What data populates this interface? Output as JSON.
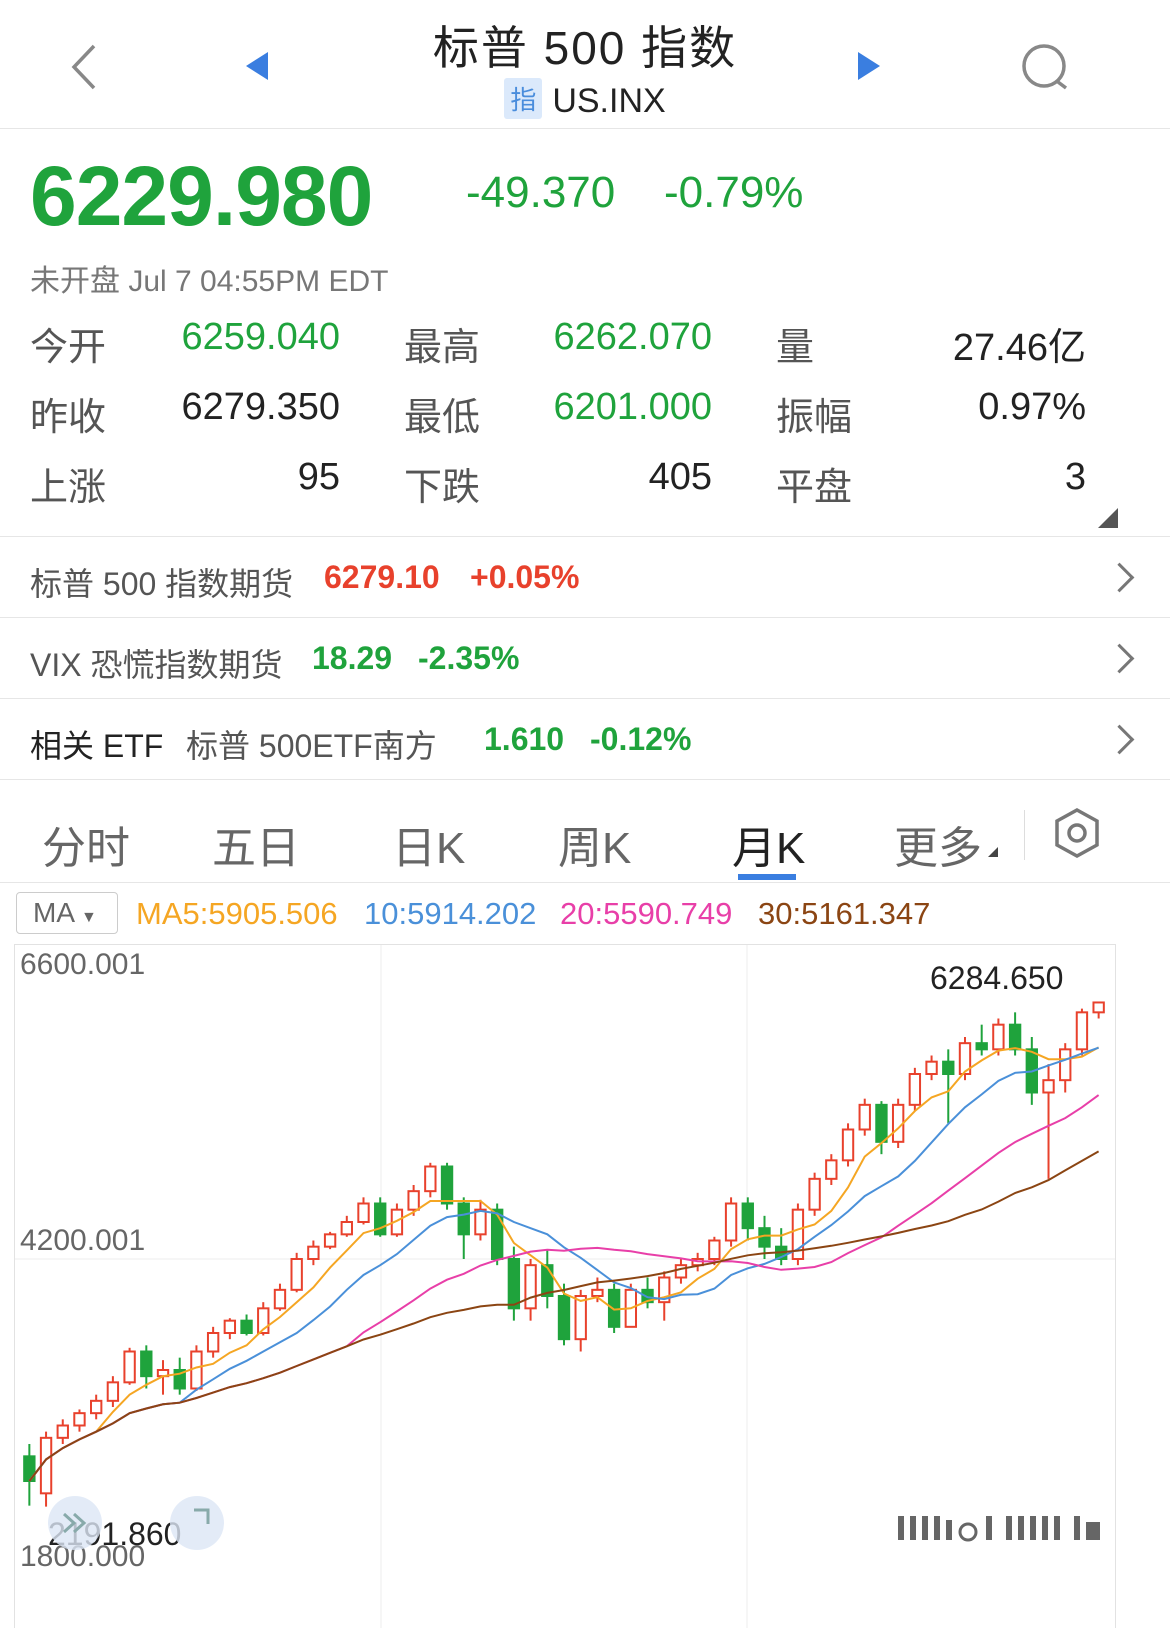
{
  "header": {
    "title": "标普 500 指数",
    "badge": "指",
    "symbol": "US.INX"
  },
  "quote": {
    "price": "6229.980",
    "change": "-49.370",
    "change_pct": "-0.79%",
    "status": "未开盘 Jul 7 04:55PM EDT"
  },
  "stats": [
    {
      "label": "今开",
      "value": "6259.040",
      "color": "green"
    },
    {
      "label": "最高",
      "value": "6262.070",
      "color": "green"
    },
    {
      "label": "量",
      "value": "27.46亿",
      "color": "dark"
    },
    {
      "label": "昨收",
      "value": "6279.350",
      "color": "dark"
    },
    {
      "label": "最低",
      "value": "6201.000",
      "color": "green"
    },
    {
      "label": "振幅",
      "value": "0.97%",
      "color": "dark"
    },
    {
      "label": "上涨",
      "value": "95",
      "color": "dark"
    },
    {
      "label": "下跌",
      "value": "405",
      "color": "dark"
    },
    {
      "label": "平盘",
      "value": "3",
      "color": "dark"
    }
  ],
  "related": [
    {
      "label": "标普 500 指数期货",
      "price": "6279.10",
      "pct": "+0.05%",
      "color": "red"
    },
    {
      "label": "VIX 恐慌指数期货",
      "price": "18.29",
      "pct": "-2.35%",
      "color": "green"
    },
    {
      "label": "相关 ETF",
      "sub": "标普 500ETF南方",
      "price": "1.610",
      "pct": "-0.12%",
      "color": "green"
    }
  ],
  "tabs": [
    "分时",
    "五日",
    "日K",
    "周K",
    "月K",
    "更多"
  ],
  "active_tab": "月K",
  "ma": {
    "selector": "MA",
    "ma5": "MA5:5905.506",
    "ma10": "10:5914.202",
    "ma20": "20:5590.749",
    "ma30": "30:5161.347"
  },
  "colors": {
    "up": "#e8412c",
    "down": "#1fa33c",
    "ma5": "#f5a623",
    "ma10": "#4a90d9",
    "ma20": "#e83fa8",
    "ma30": "#8b4513"
  },
  "chart_data": {
    "type": "candlestick",
    "y_labels": [
      "6600.001",
      "4200.001",
      "1800.000"
    ],
    "ylim": [
      1800,
      6600
    ],
    "max_label": "6284.650",
    "min_label": "2191.860",
    "candles": [
      [
        2600,
        2400,
        2700,
        2200
      ],
      [
        2300,
        2750,
        2800,
        2191.86
      ],
      [
        2750,
        2850,
        2900,
        2700
      ],
      [
        2850,
        2950,
        2980,
        2800
      ],
      [
        2950,
        3050,
        3100,
        2900
      ],
      [
        3050,
        3200,
        3250,
        3000
      ],
      [
        3200,
        3450,
        3480,
        3180
      ],
      [
        3450,
        3250,
        3500,
        3150
      ],
      [
        3250,
        3300,
        3380,
        3100
      ],
      [
        3300,
        3150,
        3400,
        3100
      ],
      [
        3150,
        3450,
        3500,
        3130
      ],
      [
        3450,
        3600,
        3650,
        3400
      ],
      [
        3600,
        3700,
        3720,
        3550
      ],
      [
        3700,
        3600,
        3750,
        3580
      ],
      [
        3600,
        3800,
        3850,
        3580
      ],
      [
        3800,
        3950,
        4000,
        3780
      ],
      [
        3950,
        4200,
        4250,
        3930
      ],
      [
        4200,
        4300,
        4350,
        4150
      ],
      [
        4300,
        4400,
        4420,
        4280
      ],
      [
        4400,
        4500,
        4550,
        4380
      ],
      [
        4500,
        4650,
        4700,
        4480
      ],
      [
        4650,
        4400,
        4700,
        4380
      ],
      [
        4400,
        4600,
        4650,
        4380
      ],
      [
        4600,
        4750,
        4800,
        4550
      ],
      [
        4750,
        4950,
        4980,
        4700
      ],
      [
        4950,
        4650,
        4980,
        4600
      ],
      [
        4650,
        4400,
        4700,
        4200
      ],
      [
        4400,
        4600,
        4680,
        4350
      ],
      [
        4600,
        4200,
        4650,
        4150
      ],
      [
        4200,
        3800,
        4300,
        3700
      ],
      [
        3800,
        4150,
        4200,
        3700
      ],
      [
        4150,
        3900,
        4280,
        3800
      ],
      [
        3900,
        3550,
        4000,
        3500
      ],
      [
        3550,
        3900,
        3950,
        3450
      ],
      [
        3900,
        3950,
        4050,
        3850
      ],
      [
        3950,
        3650,
        4000,
        3600
      ],
      [
        3650,
        3950,
        4000,
        3650
      ],
      [
        3950,
        3850,
        4050,
        3800
      ],
      [
        3850,
        4050,
        4100,
        3700
      ],
      [
        4050,
        4150,
        4200,
        4000
      ],
      [
        4150,
        4200,
        4250,
        4100
      ],
      [
        4200,
        4350,
        4380,
        4150
      ],
      [
        4350,
        4650,
        4700,
        4300
      ],
      [
        4650,
        4450,
        4700,
        4350
      ],
      [
        4450,
        4300,
        4550,
        4200
      ],
      [
        4300,
        4200,
        4450,
        4150
      ],
      [
        4200,
        4600,
        4650,
        4150
      ],
      [
        4600,
        4850,
        4900,
        4550
      ],
      [
        4850,
        5000,
        5050,
        4800
      ],
      [
        5000,
        5250,
        5300,
        4950
      ],
      [
        5250,
        5450,
        5500,
        5200
      ],
      [
        5450,
        5150,
        5480,
        5050
      ],
      [
        5150,
        5450,
        5500,
        5100
      ],
      [
        5450,
        5700,
        5750,
        5400
      ],
      [
        5700,
        5800,
        5850,
        5650
      ],
      [
        5800,
        5700,
        5900,
        5300
      ],
      [
        5700,
        5950,
        6000,
        5650
      ],
      [
        5950,
        5900,
        6100,
        5850
      ],
      [
        5900,
        6100,
        6150,
        5850
      ],
      [
        6100,
        5900,
        6200,
        5850
      ],
      [
        5900,
        5550,
        6000,
        5450
      ],
      [
        5550,
        5650,
        5780,
        4850
      ],
      [
        5650,
        5900,
        5950,
        5550
      ],
      [
        5900,
        6200,
        6230,
        5850
      ],
      [
        6200,
        6280,
        6284.65,
        6150
      ]
    ]
  }
}
